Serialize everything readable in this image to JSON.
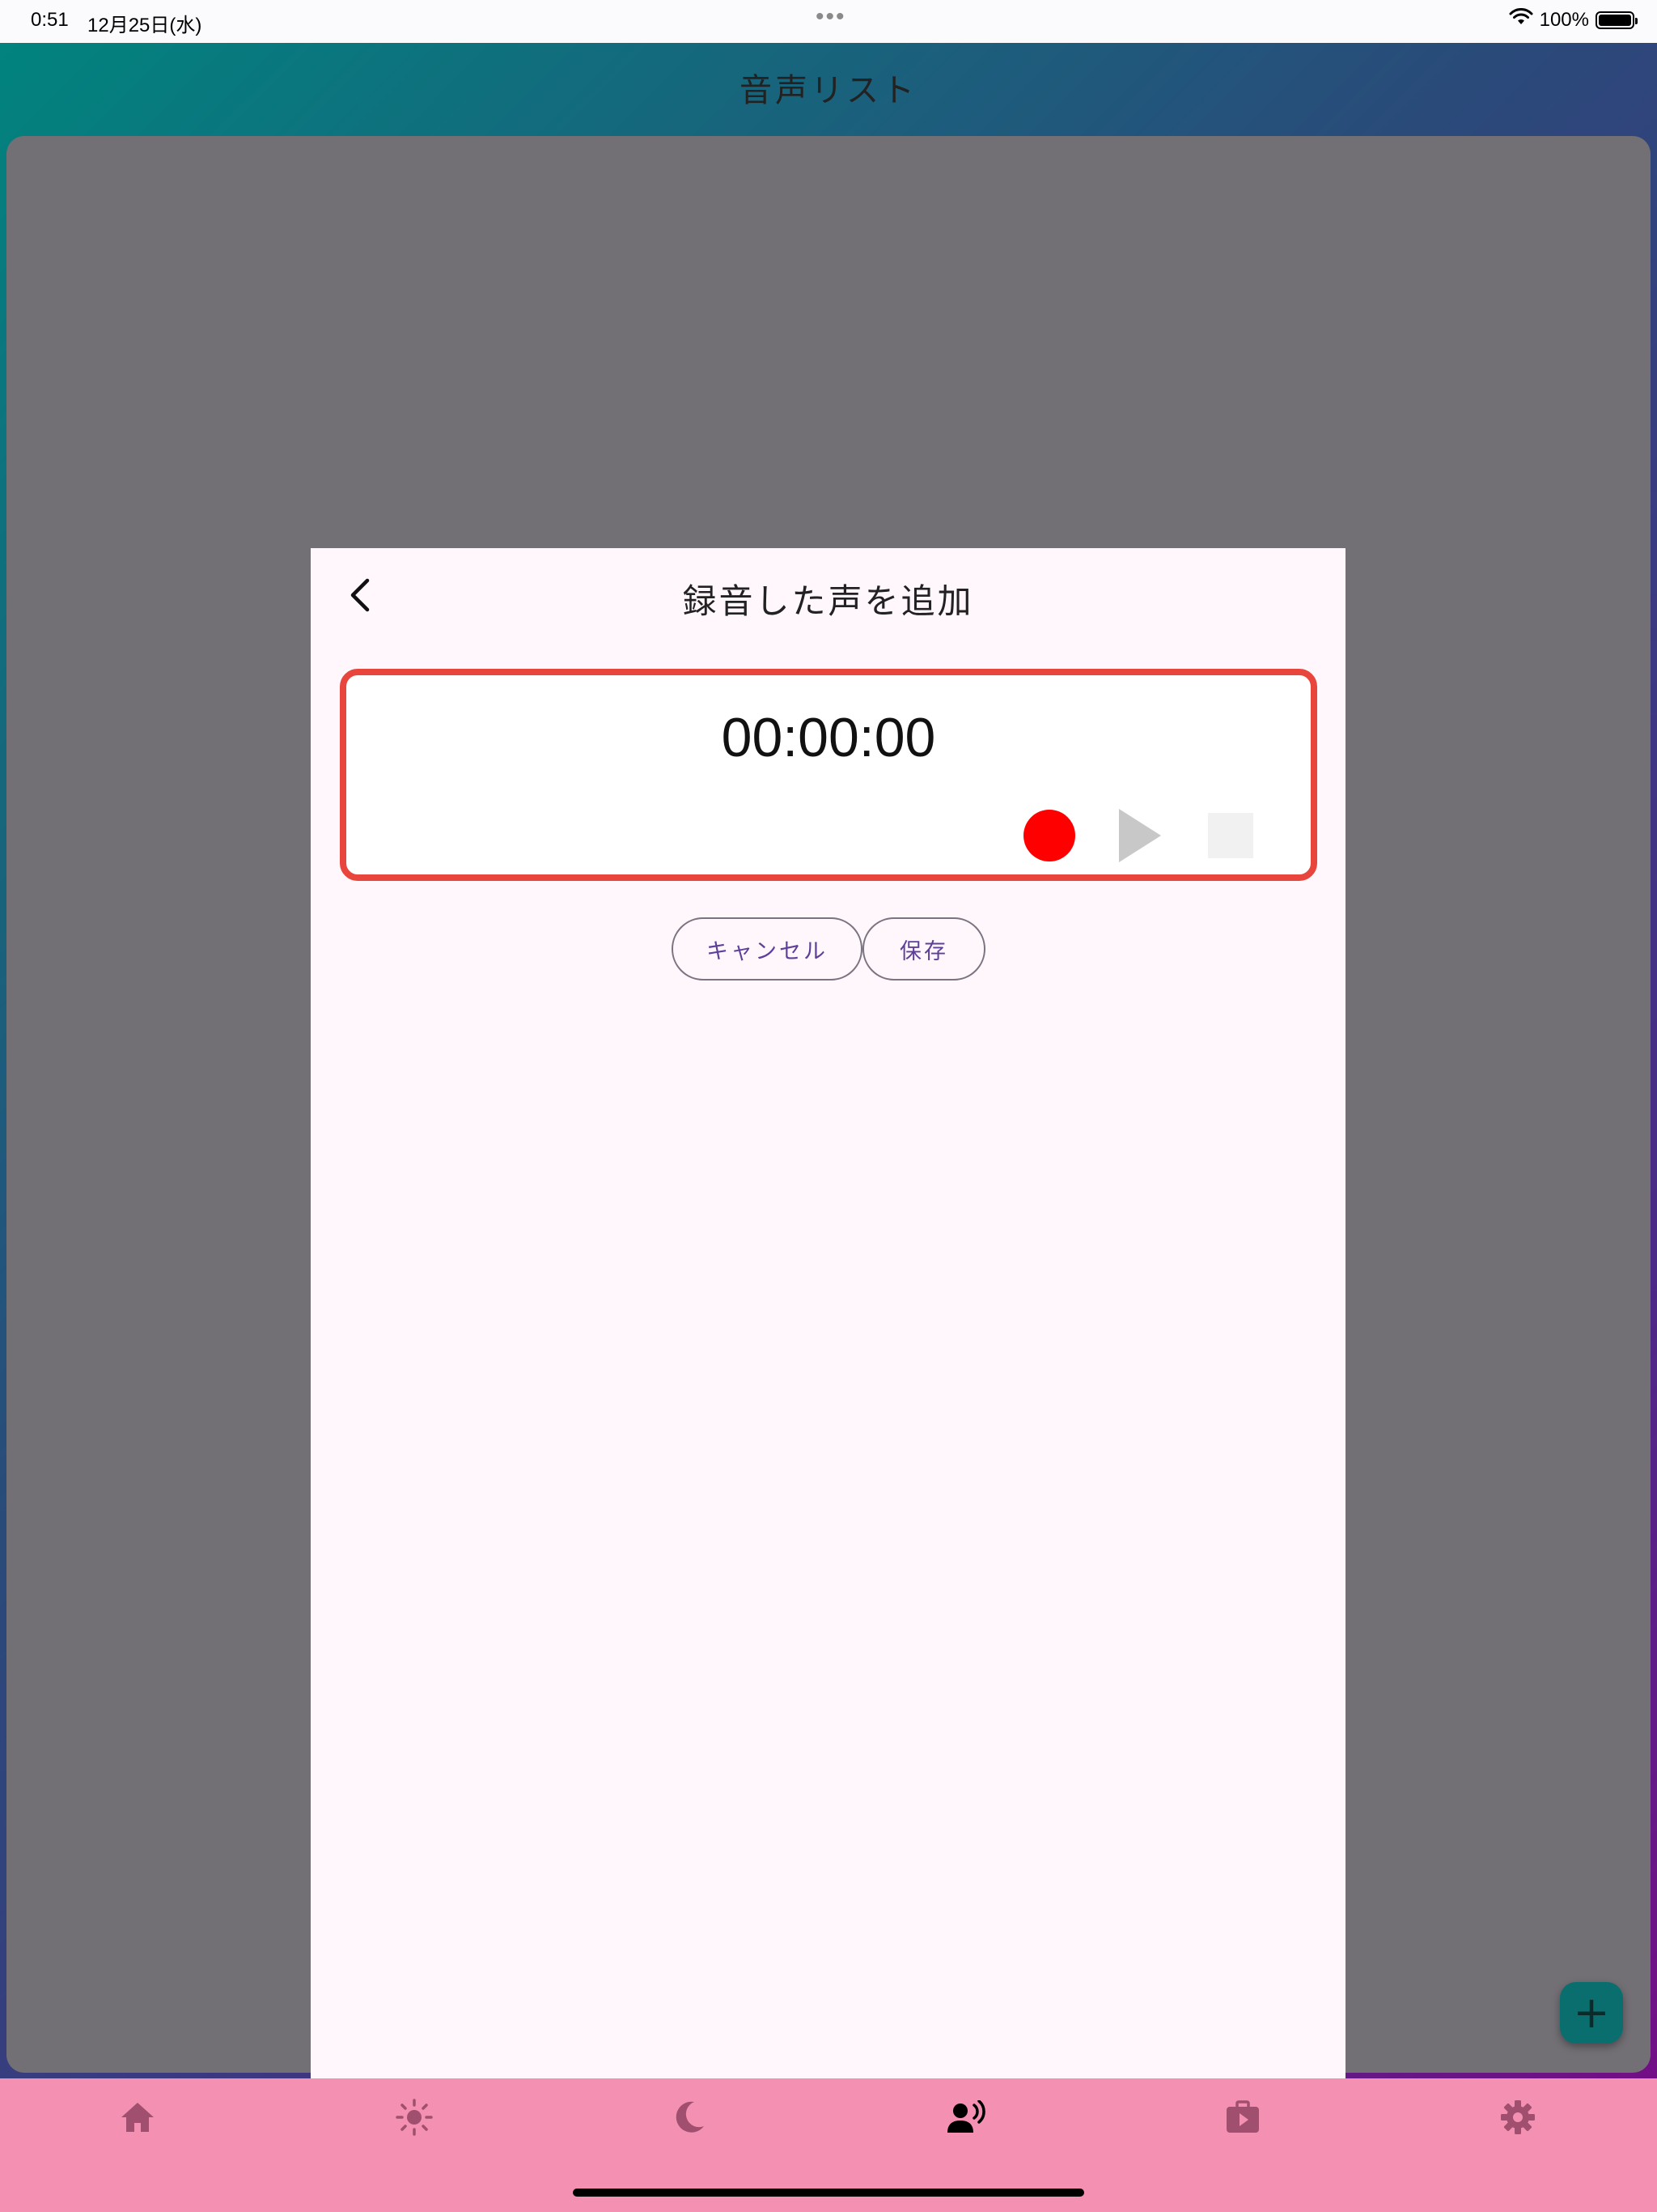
{
  "status_bar": {
    "time": "0:51",
    "date": "12月25日(水)",
    "dots": "•••",
    "battery": "100%"
  },
  "app": {
    "title": "音声リスト"
  },
  "modal": {
    "title": "録音した声を追加",
    "timer": "00:00:00",
    "cancel_label": "キャンセル",
    "save_label": "保存"
  },
  "fab": {
    "icon": "plus-icon",
    "label": "+"
  },
  "bottom_nav": {
    "items": [
      {
        "icon": "home-icon",
        "active": false
      },
      {
        "icon": "sun-icon",
        "active": false
      },
      {
        "icon": "moon-icon",
        "active": false
      },
      {
        "icon": "voice-icon",
        "active": true
      },
      {
        "icon": "briefcase-play-icon",
        "active": false
      },
      {
        "icon": "gear-icon",
        "active": false
      }
    ]
  },
  "colors": {
    "nav_background": "#f490b1",
    "nav_icon": "#a0506e",
    "nav_icon_active": "#000000",
    "record": "#ff0000",
    "recorder_border": "#e8453c",
    "accent_text": "#5e3f9a",
    "overlay": "#727075",
    "modal_background": "#fff7fc"
  }
}
